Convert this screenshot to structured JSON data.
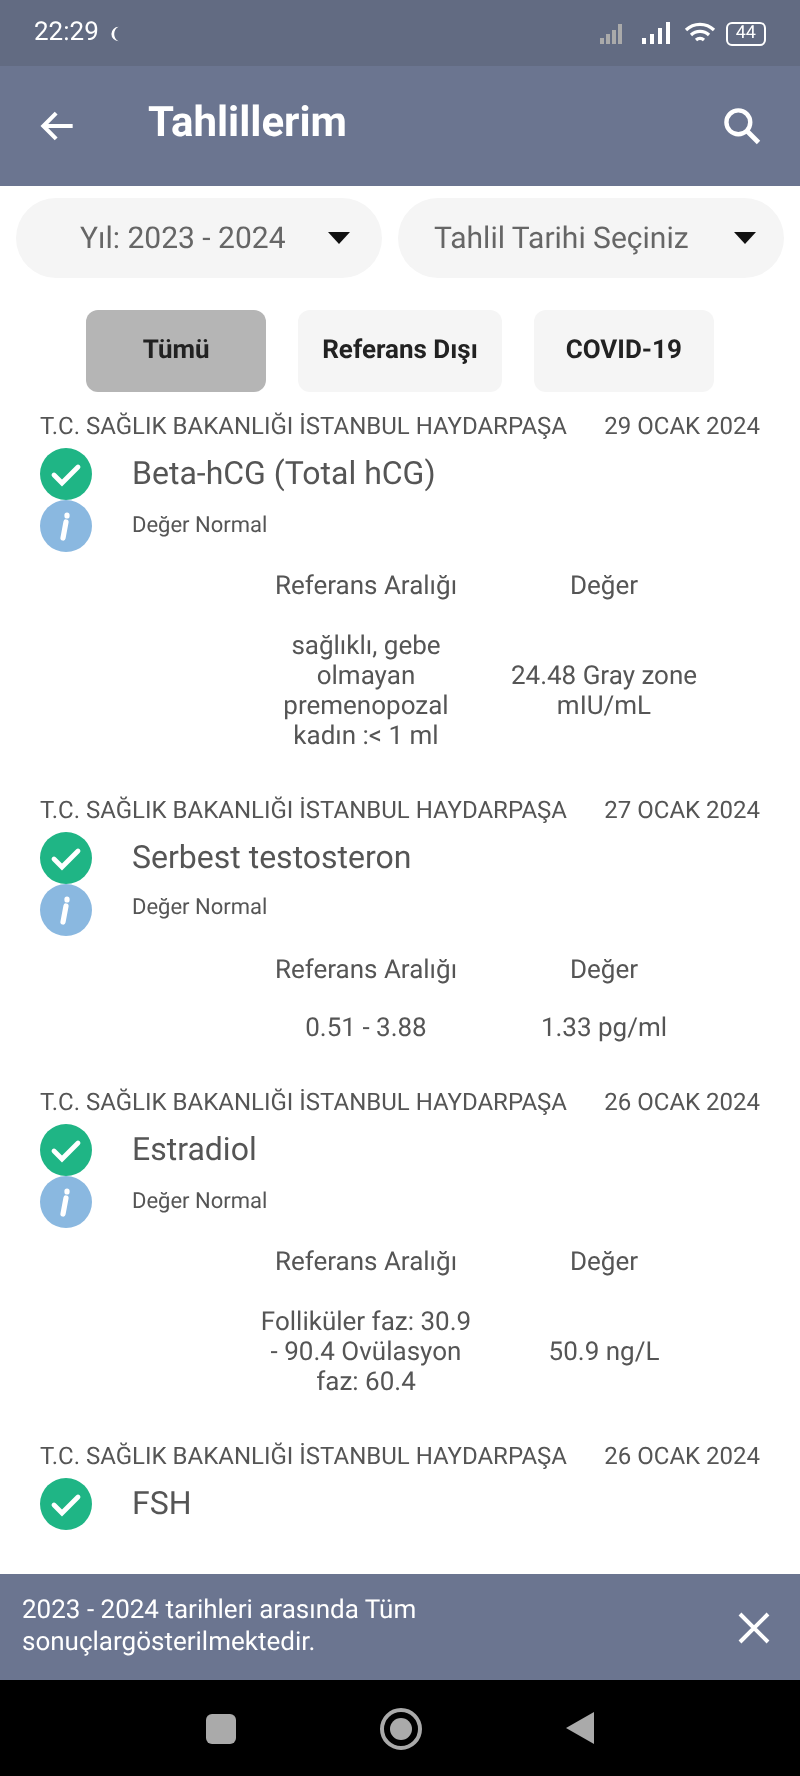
{
  "status_bar": {
    "time": "22:29",
    "battery": "44"
  },
  "app_bar": {
    "title": "Tahlillerim"
  },
  "filters": {
    "year": {
      "value": "Yıl: 2023 - 2024"
    },
    "date": {
      "placeholder": "Tahlil Tarihi Seçiniz"
    }
  },
  "tabs": [
    {
      "label": "Tümü",
      "selected": true
    },
    {
      "label": "Referans Dışı",
      "selected": false
    },
    {
      "label": "COVID-19",
      "selected": false
    }
  ],
  "results": [
    {
      "institution": "T.C. SAĞLIK BAKANLIĞI İSTANBUL HAYDARPAŞA",
      "date": "29 OCAK 2024",
      "name": "Beta-hCG (Total hCG)",
      "normal": true,
      "status": "Değer Normal",
      "ref_header": "Referans Aralığı",
      "value_header": "Değer",
      "reference": "sağlıklı, gebe olmayan premenopozal kadın :<  1 ml",
      "value": "24.48 Gray zone mIU/mL"
    },
    {
      "institution": "T.C. SAĞLIK BAKANLIĞI İSTANBUL HAYDARPAŞA",
      "date": "27 OCAK 2024",
      "name": "Serbest testosteron",
      "normal": true,
      "status": "Değer Normal",
      "ref_header": "Referans Aralığı",
      "value_header": "Değer",
      "reference": "0.51 - 3.88",
      "value": "1.33 pg/ml"
    },
    {
      "institution": "T.C. SAĞLIK BAKANLIĞI İSTANBUL HAYDARPAŞA",
      "date": "26 OCAK 2024",
      "name": "Estradiol",
      "normal": true,
      "status": "Değer Normal",
      "ref_header": "Referans Aralığı",
      "value_header": "Değer",
      "reference": "Folliküler faz: 30.9 - 90.4 Ovülasyon faz: 60.4",
      "value": "50.9 ng/L"
    },
    {
      "institution": "T.C. SAĞLIK BAKANLIĞI İSTANBUL HAYDARPAŞA",
      "date": "26 OCAK 2024",
      "name": "FSH",
      "normal": true
    }
  ],
  "snackbar": {
    "message": "2023 - 2024 tarihleri arasında Tüm sonuçlargösterilmektedir."
  }
}
